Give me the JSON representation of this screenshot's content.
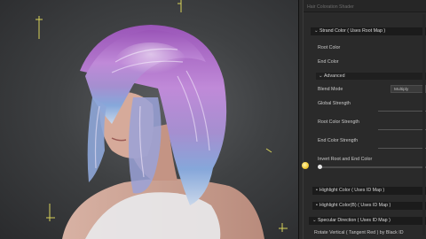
{
  "panel": {
    "title": "Hair Coloration Shader",
    "sections": {
      "strand_color": "Strand Color ( Uses Root Map )",
      "advanced": "Advanced",
      "highlight_color": "Highlight Color ( Uses ID Map )",
      "highlight_color_b": "Highlight Color(B) ( Uses ID Map )",
      "specular_direction": "Specular Direction ( Uses ID Map )"
    },
    "labels": {
      "root_color": "Root Color",
      "end_color": "End Color",
      "blend_mode": "Blend Mode",
      "global_strength": "Global Strength",
      "root_color_strength": "Root Color Strength",
      "end_color_strength": "End Color Strength",
      "invert_root_end": "Invert Root and End Color",
      "rotate_vertical": "Rotate Vertical ( Tangent Red ) by Black ID"
    },
    "blend_mode_value": "Multiply",
    "invert_toggle_on": false
  },
  "colors": {
    "hair_purple": "#b07fd0",
    "hair_blue": "#7ea4d8",
    "panel_bg": "#2a2a2a",
    "header_bg": "#1b1b1b",
    "hint_yellow": "#f2cc3c"
  }
}
